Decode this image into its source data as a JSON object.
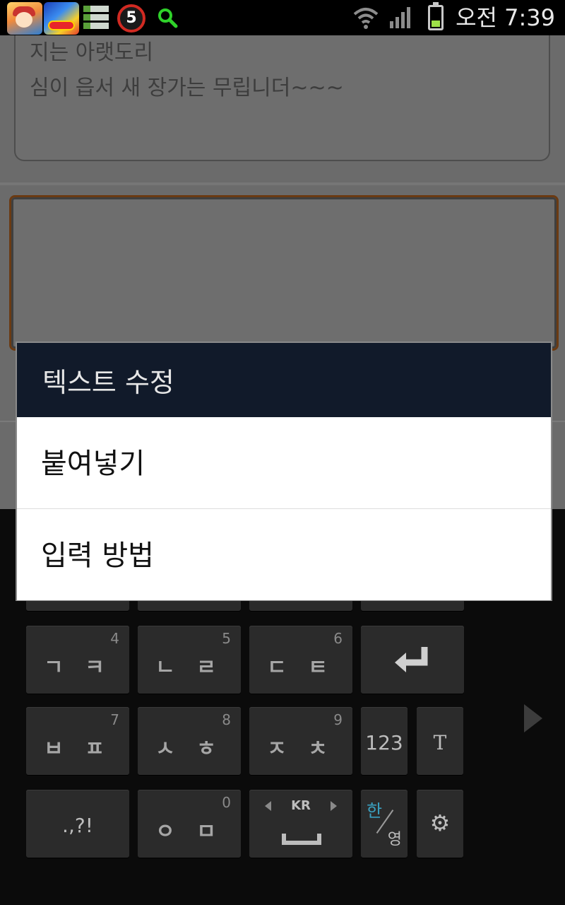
{
  "status_bar": {
    "time": "오전 7:39",
    "timer_count": "5",
    "icons": [
      "app-icon-pilot-game",
      "app-icon-racing-game",
      "app-icon-list",
      "timer-icon",
      "search-icon",
      "wifi-icon",
      "signal-icon",
      "battery-icon"
    ],
    "battery_color": "#9ee048"
  },
  "chat": {
    "message_lines": [
      "지는 아랫도리",
      "심이 읍서 새 장가는 무립니더~~~"
    ],
    "reply_value": ""
  },
  "dialog": {
    "title": "텍스트 수정",
    "items": [
      {
        "label": "붙여넣기"
      },
      {
        "label": "입력 방법"
      }
    ],
    "title_bg": "#111a2a"
  },
  "keyboard": {
    "rows": [
      [
        {
          "label": "ㄱ ㅋ",
          "num": "4"
        },
        {
          "label": "ㄴ ㄹ",
          "num": "5"
        },
        {
          "label": "ㄷ ㅌ",
          "num": "6"
        },
        {
          "label": "↵",
          "num": ""
        }
      ],
      [
        {
          "label": "ㅂ ㅍ",
          "num": "7"
        },
        {
          "label": "ㅅ ㅎ",
          "num": "8"
        },
        {
          "label": "ㅈ ㅊ",
          "num": "9"
        },
        {
          "label": "123",
          "num": ""
        },
        {
          "label": "T",
          "num": ""
        }
      ],
      [
        {
          "label": ".,?!",
          "num": ""
        },
        {
          "label": "ㅇ ㅁ",
          "num": "0"
        },
        {
          "label": "KR",
          "num": ""
        },
        {
          "label_top": "한",
          "label_bottom": "영",
          "num": ""
        },
        {
          "label": "⚙",
          "num": ""
        }
      ]
    ],
    "next_page_arrow": "chevron-right-icon"
  }
}
